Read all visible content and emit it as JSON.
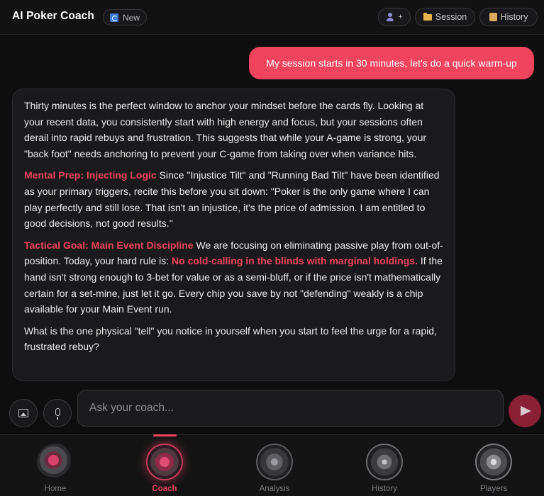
{
  "header": {
    "title": "AI Poker Coach",
    "new_label": "New",
    "add_player_label": "+",
    "session_label": "Session",
    "history_label": "History"
  },
  "chat": {
    "user_message": "My session starts in 30 minutes, let's do a quick warm-up",
    "assistant": {
      "p1": "Thirty minutes is the perfect window to anchor your mindset before the cards fly. Looking at your recent data, you consistently start with high energy and focus, but your sessions often derail into rapid rebuys and frustration. This suggests that while your A-game is strong, your \"back foot\" needs anchoring to prevent your C-game from taking over when variance hits.",
      "p2_heading": "Mental Prep: Injecting Logic",
      "p2_body": " Since \"Injustice Tilt\" and \"Running Bad Tilt\" have been identified as your primary triggers, recite this before you sit down: \"Poker is the only game where I can play perfectly and still lose. That isn't an injustice, it's the price of admission. I am entitled to good decisions, not good results.\"",
      "p3_heading": "Tactical Goal: Main Event Discipline",
      "p3_body_a": " We are focusing on eliminating passive play from out-of-position. Today, your hard rule is: ",
      "p3_rule": "No cold-calling in the blinds with marginal holdings.",
      "p3_body_b": " If the hand isn't strong enough to 3-bet for value or as a semi-bluff, or if the price isn't mathematically certain for a set-mine, just let it go. Every chip you save by not \"defending\" weakly is a chip available for your Main Event run.",
      "p4": "What is the one physical \"tell\" you notice in yourself when you start to feel the urge for a rapid, frustrated rebuy?"
    }
  },
  "composer": {
    "placeholder": "Ask your coach..."
  },
  "nav": {
    "items": [
      {
        "label": "Home"
      },
      {
        "label": "Coach"
      },
      {
        "label": "Analysis"
      },
      {
        "label": "History"
      },
      {
        "label": "Players"
      }
    ],
    "active": "Coach"
  },
  "colors": {
    "accent": "#f0435e",
    "background": "#0e0e0f",
    "bubble": "#1a1a1c"
  }
}
